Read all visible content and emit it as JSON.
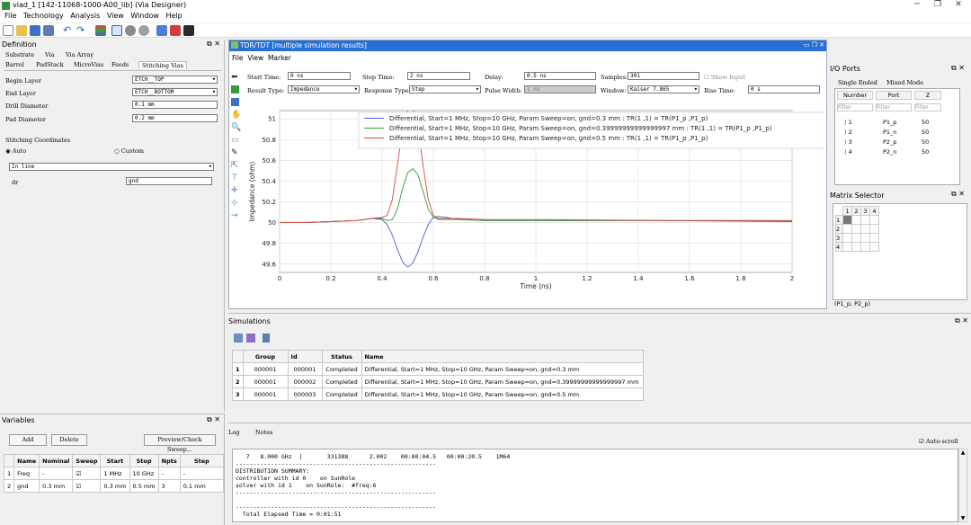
{
  "window": {
    "title": "viad_1 [142-11068-1000-A00_lib] (Via Designer)"
  },
  "menu": [
    "File",
    "Technology",
    "Analysis",
    "View",
    "Window",
    "Help"
  ],
  "definition": {
    "title": "Definition",
    "tabs_row1": [
      "Substrate",
      "Via",
      "Via Array"
    ],
    "tabs_row2": [
      "Barrel",
      "PadStack",
      "MicroVias",
      "Feeds",
      "Stitching Vias"
    ],
    "begin_layer_label": "Begin Layer",
    "begin_layer": "ETCH__TOP",
    "end_layer_label": "End Layer",
    "end_layer": "ETCH__BOTTOM",
    "drill_label": "Drill Diameter",
    "drill": "0.1 mm",
    "pad_label": "Pad Diameter",
    "pad": "0.2 mm",
    "stitch_label": "Stitching Coordinates",
    "auto_label": "Auto",
    "custom_label": "Custom",
    "placement": "In line",
    "dr_label": "dr",
    "dr": "gnd"
  },
  "variables": {
    "title": "Variables",
    "add": "Add",
    "delete": "Delete",
    "preview": "Preview/Check Sweep...",
    "headers": [
      "",
      "Name",
      "Nominal",
      "Sweep",
      "Start",
      "Stop",
      "Npts",
      "Step"
    ],
    "rows": [
      [
        "1",
        "Freq",
        "-",
        "☑",
        "1 MHz",
        "10 GHz",
        "-",
        "-"
      ],
      [
        "2",
        "gnd",
        "0.3 mm",
        "☑",
        "0.3 mm",
        "0.5 mm",
        "3",
        "0.1 mm"
      ]
    ]
  },
  "tdr": {
    "title": "TDR/TDT [multiple simulation results]",
    "menu": [
      "File",
      "View",
      "Marker"
    ],
    "start_label": "Start Time:",
    "start": "0 ns",
    "step_label": "Step Time:",
    "step": "2 ns",
    "delay_label": "Delay:",
    "delay": "0.5 ns",
    "samples_label": "Samples:",
    "samples": "301",
    "show_input": "Show Input",
    "result_label": "Result Type:",
    "result": "Impedance",
    "response_label": "Response Type:",
    "response": "Step",
    "pulse_label": "Pulse Width:",
    "pulse": "1 ns",
    "window_label": "Window:",
    "window": "Kaiser 7.865",
    "rise_label": "Rise Time:",
    "rise": "0 s"
  },
  "chart_data": {
    "type": "line",
    "title": "",
    "xlabel": "Time (ns)",
    "ylabel": "Impedance (ohm)",
    "xlim": [
      0,
      2
    ],
    "ylim": [
      49.52,
      51.08
    ],
    "xticks": [
      "0",
      "0.2",
      "0.4",
      "0.6",
      "0.8",
      "1",
      "1.2",
      "1.4",
      "1.6",
      "1.8",
      "2"
    ],
    "yticks": [
      "49.6",
      "49.8",
      "50",
      "50.2",
      "50.4",
      "50.6",
      "50.8",
      "51"
    ],
    "grid": true,
    "legend_position": "top-right",
    "series": [
      {
        "name": "Differential, Start=1 MHz, Stop=10 GHz, Param Sweep=on, gnd=0.3 mm : TR(1 ,1) = TR(P1_p ,P1_p)",
        "color": "#4a5de0",
        "x": [
          0,
          0.1,
          0.2,
          0.3,
          0.36,
          0.4,
          0.42,
          0.44,
          0.46,
          0.48,
          0.5,
          0.52,
          0.54,
          0.56,
          0.58,
          0.6,
          0.62,
          0.65,
          0.7,
          0.8,
          1.0,
          1.5,
          2.0
        ],
        "y": [
          50.0,
          50.0,
          50.01,
          50.02,
          50.04,
          50.03,
          49.98,
          49.88,
          49.74,
          49.62,
          49.57,
          49.61,
          49.72,
          49.86,
          49.98,
          50.05,
          50.06,
          50.05,
          50.03,
          50.02,
          50.02,
          50.02,
          50.01
        ]
      },
      {
        "name": "Differential, Start=1 MHz, Stop=10 GHz, Param Sweep=on, gnd=0.39999999999999997 mm : TR(1 ,1) = TR(P1_p ,P1_p)",
        "color": "#2e9e2e",
        "x": [
          0,
          0.1,
          0.2,
          0.3,
          0.36,
          0.4,
          0.42,
          0.44,
          0.46,
          0.48,
          0.5,
          0.52,
          0.54,
          0.56,
          0.58,
          0.6,
          0.62,
          0.65,
          0.7,
          0.8,
          1.0,
          1.5,
          2.0
        ],
        "y": [
          50.0,
          50.0,
          50.01,
          50.02,
          50.04,
          50.04,
          50.02,
          50.03,
          50.13,
          50.33,
          50.48,
          50.52,
          50.46,
          50.3,
          50.13,
          50.05,
          50.03,
          50.03,
          50.03,
          50.02,
          50.02,
          50.02,
          50.02
        ]
      },
      {
        "name": "Differential, Start=1 MHz, Stop=10 GHz, Param Sweep=on, gnd=0.5 mm : TR(1 ,1) = TR(P1_p ,P1_p)",
        "color": "#e04545",
        "x": [
          0,
          0.1,
          0.2,
          0.3,
          0.36,
          0.4,
          0.42,
          0.44,
          0.46,
          0.48,
          0.5,
          0.52,
          0.54,
          0.56,
          0.58,
          0.6,
          0.62,
          0.65,
          0.7,
          0.8,
          1.0,
          1.5,
          2.0
        ],
        "y": [
          50.0,
          50.0,
          50.01,
          50.02,
          50.04,
          50.05,
          50.07,
          50.22,
          50.56,
          50.9,
          51.08,
          51.1,
          50.92,
          50.55,
          50.22,
          50.07,
          50.04,
          50.04,
          50.04,
          50.03,
          50.03,
          50.02,
          50.02
        ]
      }
    ]
  },
  "io_ports": {
    "title": "I/O Ports",
    "tabs": [
      "Single Ended",
      "Mixed Mode"
    ],
    "headers": [
      "Number",
      "Port",
      "Z"
    ],
    "filter": "Filter",
    "rows": [
      [
        "1",
        "P1_p",
        "50"
      ],
      [
        "2",
        "P1_n",
        "50"
      ],
      [
        "3",
        "P2_p",
        "50"
      ],
      [
        "4",
        "P2_n",
        "50"
      ]
    ]
  },
  "matrix": {
    "title": "Matrix Selector",
    "cols": [
      "1",
      "2",
      "3",
      "4"
    ],
    "rows": [
      "1",
      "2",
      "3",
      "4"
    ],
    "selection": "(P1_p, P2_p)"
  },
  "simulations": {
    "title": "Simulations",
    "headers": [
      "",
      "Group",
      "Id",
      "Status",
      "Name"
    ],
    "rows": [
      [
        "1",
        "000001",
        "000001",
        "Completed",
        "Differential, Start=1 MHz, Stop=10 GHz, Param Sweep=on, gnd=0.3 mm"
      ],
      [
        "2",
        "000001",
        "000002",
        "Completed",
        "Differential, Start=1 MHz, Stop=10 GHz, Param Sweep=on, gnd=0.39999999999999997 mm"
      ],
      [
        "3",
        "000001",
        "000003",
        "Completed",
        "Differential, Start=1 MHz, Stop=10 GHz, Param Sweep=on, gnd=0.5 mm"
      ]
    ]
  },
  "log": {
    "tabs": [
      "Log",
      "Notes"
    ],
    "autoscroll": "Auto-scroll",
    "lines": [
      "   7   8.000 GHz  |       331388      2.002    00:00:04.5   00:00:20.5    1M64",
      "---------------------------------------------------------",
      "DISTRIBUTION SUMMARY:",
      "controller with id 0    on SunRole",
      "solver with id 1    on SunRole:  #freq:6",
      "---------------------------------------------------------",
      "",
      "---------------------------------------------------------",
      "  Total Elapsed Time = 0:01:51",
      "---------------------------------------------------------"
    ]
  }
}
